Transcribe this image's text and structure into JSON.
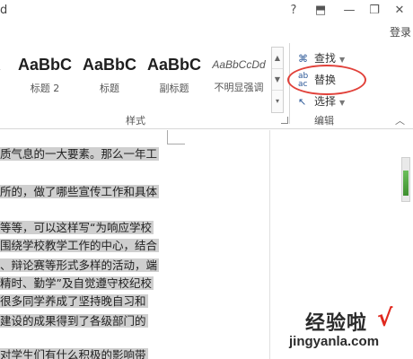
{
  "titlebar": {
    "doc_letter": "d",
    "help": "?",
    "restore_ribbon": "⬒",
    "minimize": "—",
    "maximize": "❐",
    "close": "✕",
    "login": "登录"
  },
  "styles_gallery": {
    "items": [
      {
        "preview": "ι",
        "name": ""
      },
      {
        "preview": "AaBbC",
        "name": "标题 2"
      },
      {
        "preview": "AaBbC",
        "name": "标题"
      },
      {
        "preview": "AaBbC",
        "name": "副标题"
      },
      {
        "preview": "AaBbCcDd",
        "name": "不明显强调"
      }
    ],
    "group_label": "样式"
  },
  "editing_group": {
    "find_label": "查找",
    "replace_label": "替换",
    "select_label": "选择",
    "group_label": "编辑",
    "find_icon": "binoculars-icon",
    "replace_icon": "ab-ac-replace-icon",
    "select_icon": "cursor-select-icon"
  },
  "document": {
    "lines": [
      "质气息的一大要素。那么一年工",
      "所的，做了哪些宣传工作和具体",
      "",
      "等等，可以这样写“为响应学校",
      "围绕学校教学工作的中心，结合",
      "、辩论赛等形式多样的活动，端",
      "精时、勤学”及自觉遵守校纪校",
      "很多同学养成了坚持晚自习和",
      "建设的成果得到了各级部门的",
      "",
      "对学生们有什么积极的影响带"
    ]
  },
  "watermark": {
    "title": "经验啦",
    "check": "√",
    "url": "jingyanla.com"
  },
  "colors": {
    "highlight_oval": "#e1413a",
    "selection_bg": "#cfcfcf",
    "scroll_thumb": "#3e8f2f"
  }
}
